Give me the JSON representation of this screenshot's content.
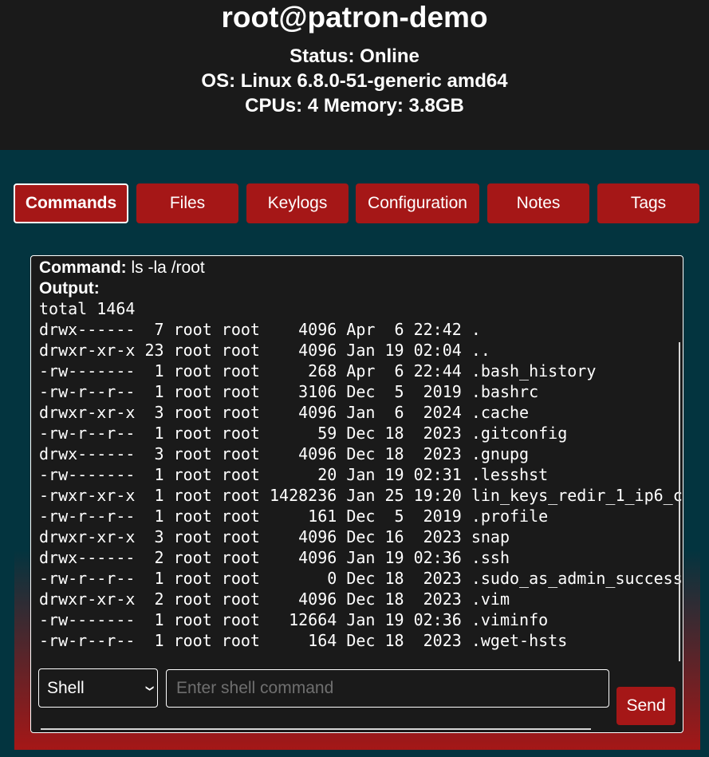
{
  "header": {
    "title": "root@patron-demo",
    "status": "Status: Online",
    "os": "OS: Linux 6.8.0-51-generic amd64",
    "resources": "CPUs: 4 Memory: 3.8GB"
  },
  "tabs": [
    {
      "label": "Commands",
      "active": true
    },
    {
      "label": "Files",
      "active": false
    },
    {
      "label": "Keylogs",
      "active": false
    },
    {
      "label": "Configuration",
      "active": false
    },
    {
      "label": "Notes",
      "active": false
    },
    {
      "label": "Tags",
      "active": false
    }
  ],
  "command": {
    "label": "Command:",
    "value": "ls -la /root"
  },
  "output": {
    "label": "Output:",
    "text": "total 1464\ndrwx------  7 root root    4096 Apr  6 22:42 .\ndrwxr-xr-x 23 root root    4096 Jan 19 02:04 ..\n-rw-------  1 root root     268 Apr  6 22:44 .bash_history\n-rw-r--r--  1 root root    3106 Dec  5  2019 .bashrc\ndrwxr-xr-x  3 root root    4096 Jan  6  2024 .cache\n-rw-r--r--  1 root root      59 Dec 18  2023 .gitconfig\ndrwx------  3 root root    4096 Dec 18  2023 .gnupg\n-rw-------  1 root root      20 Jan 19 02:31 .lesshst\n-rwxr-xr-x  1 root root 1428236 Jan 25 19:20 lin_keys_redir_1_ip6_c\n-rw-r--r--  1 root root     161 Dec  5  2019 .profile\ndrwxr-xr-x  3 root root    4096 Dec 16  2023 snap\ndrwx------  2 root root    4096 Jan 19 02:36 .ssh\n-rw-r--r--  1 root root       0 Dec 18  2023 .sudo_as_admin_successful\ndrwxr-xr-x  2 root root    4096 Dec 18  2023 .vim\n-rw-------  1 root root   12664 Jan 19 02:36 .viminfo\n-rw-r--r--  1 root root     164 Dec 18  2023 .wget-hsts"
  },
  "controls": {
    "mode_selected": "Shell",
    "input_placeholder": "Enter shell command",
    "input_value": "",
    "send_label": "Send"
  },
  "colors": {
    "header_bg": "#1a1a1a",
    "page_bg": "#03343f",
    "accent_red": "#a51717",
    "panel_bg": "#1a1a1a",
    "text": "#ffffff"
  },
  "icons": {
    "select_arrow": "chevron-down-icon"
  }
}
